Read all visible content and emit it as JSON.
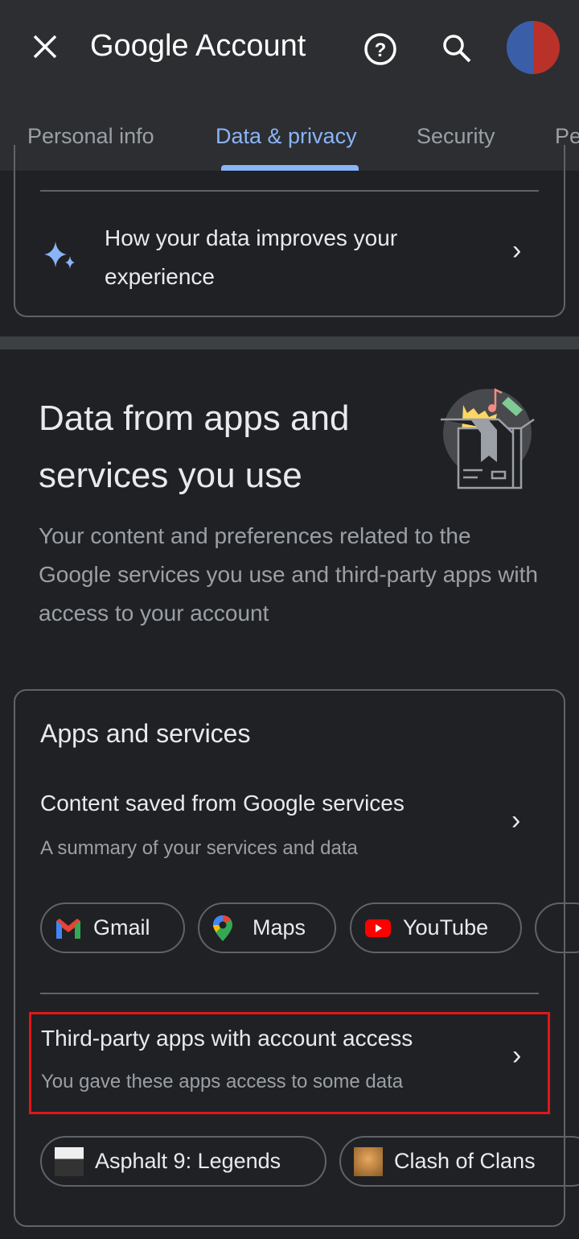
{
  "header": {
    "title": "Google Account",
    "tabs": [
      {
        "label": "Personal info"
      },
      {
        "label": "Data & privacy",
        "active": true
      },
      {
        "label": "Security"
      },
      {
        "label": "Pe"
      }
    ]
  },
  "top_card": {
    "item_label": "How your data improves your experience"
  },
  "section": {
    "title": "Data from apps and services you use",
    "description": "Your content and preferences related to the Google services you use and third-party apps with access to your account"
  },
  "apps_card": {
    "heading": "Apps and services",
    "content_saved": {
      "title": "Content saved from Google services",
      "subtitle": "A summary of your services and data"
    },
    "service_chips": [
      {
        "label": "Gmail"
      },
      {
        "label": "Maps"
      },
      {
        "label": "YouTube"
      }
    ],
    "third_party": {
      "title": "Third-party apps with account access",
      "subtitle": "You gave these apps access to some data"
    },
    "app_chips": [
      {
        "label": "Asphalt 9: Legends"
      },
      {
        "label": "Clash of Clans"
      }
    ]
  },
  "colors": {
    "accent": "#8ab4f8",
    "highlight": "#e0161b",
    "background": "#202124"
  }
}
